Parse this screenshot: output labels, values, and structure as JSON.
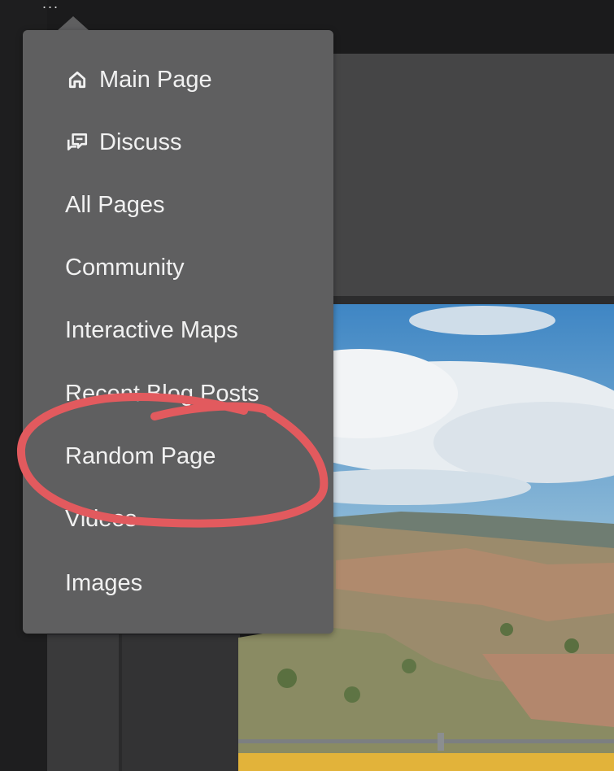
{
  "header": {
    "overflow_icon": "..."
  },
  "menu": {
    "items": [
      {
        "label": "Main Page",
        "icon": "home-icon"
      },
      {
        "label": "Discuss",
        "icon": "discuss-icon"
      },
      {
        "label": "All Pages"
      },
      {
        "label": "Community"
      },
      {
        "label": "Interactive Maps"
      },
      {
        "label": "Recent Blog Posts"
      },
      {
        "label": "Random Page"
      },
      {
        "label": "Videos"
      },
      {
        "label": "Images"
      }
    ]
  },
  "annotation": {
    "type": "hand-drawn circle",
    "target": "Random Page",
    "color": "#e25a5e"
  },
  "colors": {
    "menu_bg": "#5f5f60",
    "text": "#f1f1f1",
    "accent_bar": "#e2b33a"
  }
}
